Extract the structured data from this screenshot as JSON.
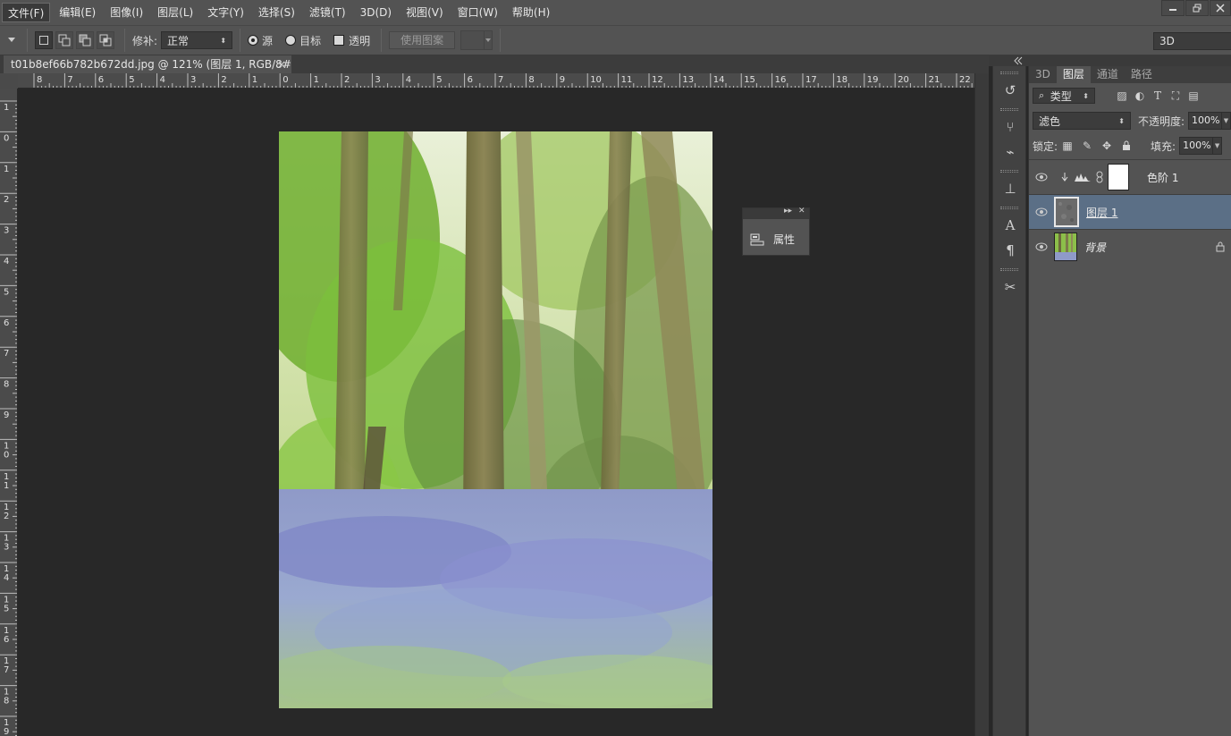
{
  "menu": {
    "items": [
      "文件(F)",
      "编辑(E)",
      "图像(I)",
      "图层(L)",
      "文字(Y)",
      "选择(S)",
      "滤镜(T)",
      "3D(D)",
      "视图(V)",
      "窗口(W)",
      "帮助(H)"
    ],
    "active_index": 0
  },
  "options": {
    "patch_label": "修补:",
    "patch_mode": "正常",
    "source_label": "源",
    "target_label": "目标",
    "transparent_label": "透明",
    "use_pattern_label": "使用图案",
    "workspace": "3D"
  },
  "document": {
    "tab_title": "t01b8ef66b782b672dd.jpg @ 121% (图层 1, RGB/8#) *",
    "close_glyph": "×"
  },
  "rulers": {
    "h_labels": [
      "8",
      "7",
      "6",
      "5",
      "4",
      "3",
      "2",
      "1",
      "0",
      "1",
      "2",
      "3",
      "4",
      "5",
      "6",
      "7",
      "8",
      "9",
      "10",
      "11",
      "12",
      "13",
      "14",
      "15",
      "16",
      "17",
      "18",
      "19",
      "20",
      "21",
      "22"
    ],
    "v_labels": [
      "1",
      "0",
      "1",
      "2",
      "3",
      "4",
      "5",
      "6",
      "7",
      "8",
      "9",
      "10",
      "11",
      "12",
      "13",
      "14",
      "15",
      "16",
      "17",
      "18",
      "19"
    ]
  },
  "properties_panel": {
    "label": "属性",
    "expand_glyph": "▸▸",
    "close_glyph": "✕"
  },
  "layers_panel": {
    "tabs": [
      "3D",
      "图层",
      "通道",
      "路径"
    ],
    "active_tab": 1,
    "filter_type": "类型",
    "blend_mode": "滤色",
    "opacity_label": "不透明度:",
    "opacity_value": "100%",
    "lock_label": "锁定:",
    "fill_label": "填充:",
    "fill_value": "100%",
    "layers": [
      {
        "name": "色阶 1",
        "kind": "adjustment",
        "selected": false
      },
      {
        "name": "图层 1",
        "kind": "pixel",
        "selected": true
      },
      {
        "name": "背景",
        "kind": "background",
        "selected": false
      }
    ]
  },
  "colors": {
    "selection": "#5b6f86",
    "panel_bg": "#535353",
    "canvas_bg": "#282828"
  }
}
